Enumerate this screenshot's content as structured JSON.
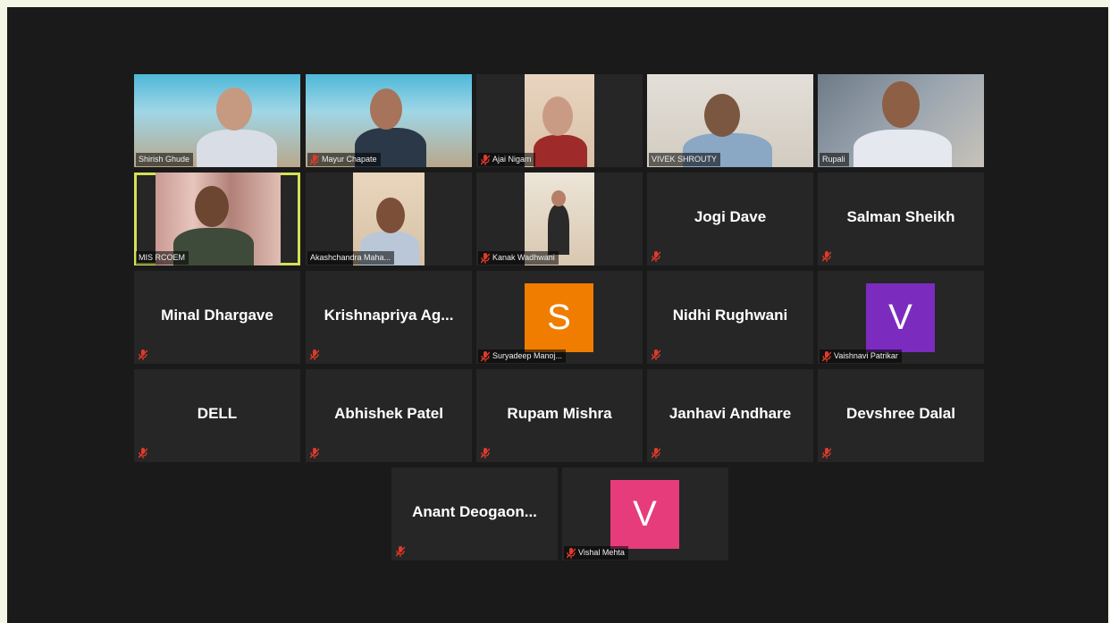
{
  "meeting": {
    "participants": [
      {
        "name": "Shirish Ghude",
        "mode": "video",
        "muted": false
      },
      {
        "name": "Mayur Chapate",
        "mode": "video",
        "muted": true
      },
      {
        "name": "Ajai Nigam",
        "mode": "video",
        "muted": true
      },
      {
        "name": "VIVEK SHROUTY",
        "mode": "video",
        "muted": false
      },
      {
        "name": "Rupali",
        "mode": "video",
        "muted": false
      },
      {
        "name": "MIS RCOEM",
        "mode": "video",
        "muted": false,
        "active_speaker": true
      },
      {
        "name": "Akashchandra Maha...",
        "mode": "video",
        "muted": false
      },
      {
        "name": "Kanak Wadhwani",
        "mode": "video",
        "muted": true
      },
      {
        "name": "Jogi Dave",
        "mode": "name",
        "muted": true
      },
      {
        "name": "Salman Sheikh",
        "mode": "name",
        "muted": true
      },
      {
        "name": "Minal Dhargave",
        "mode": "name",
        "muted": true
      },
      {
        "name": "Krishnapriya  Ag...",
        "mode": "name",
        "muted": true
      },
      {
        "name": "Suryadeep Manoj...",
        "mode": "avatar",
        "initial": "S",
        "color": "#f07d00",
        "muted": true
      },
      {
        "name": "Nidhi Rughwani",
        "mode": "name",
        "muted": true
      },
      {
        "name": "Vaishnavi Patrikar",
        "mode": "avatar",
        "initial": "V",
        "color": "#7b2cbf",
        "muted": true
      },
      {
        "name": "DELL",
        "mode": "name",
        "muted": true
      },
      {
        "name": "Abhishek Patel",
        "mode": "name",
        "muted": true
      },
      {
        "name": "Rupam Mishra",
        "mode": "name",
        "muted": true
      },
      {
        "name": "Janhavi Andhare",
        "mode": "name",
        "muted": true
      },
      {
        "name": "Devshree Dalal",
        "mode": "name",
        "muted": true
      },
      {
        "name": "Anant  Deogaon...",
        "mode": "name",
        "muted": true
      },
      {
        "name": "Vishal Mehta",
        "mode": "avatar",
        "initial": "V",
        "color": "#e63c7b",
        "muted": true
      }
    ]
  },
  "colors": {
    "muted_icon": "#e03a2a",
    "active_border": "#d4e157",
    "tile_bg": "#262626",
    "stage_bg": "#1a1a1a"
  }
}
